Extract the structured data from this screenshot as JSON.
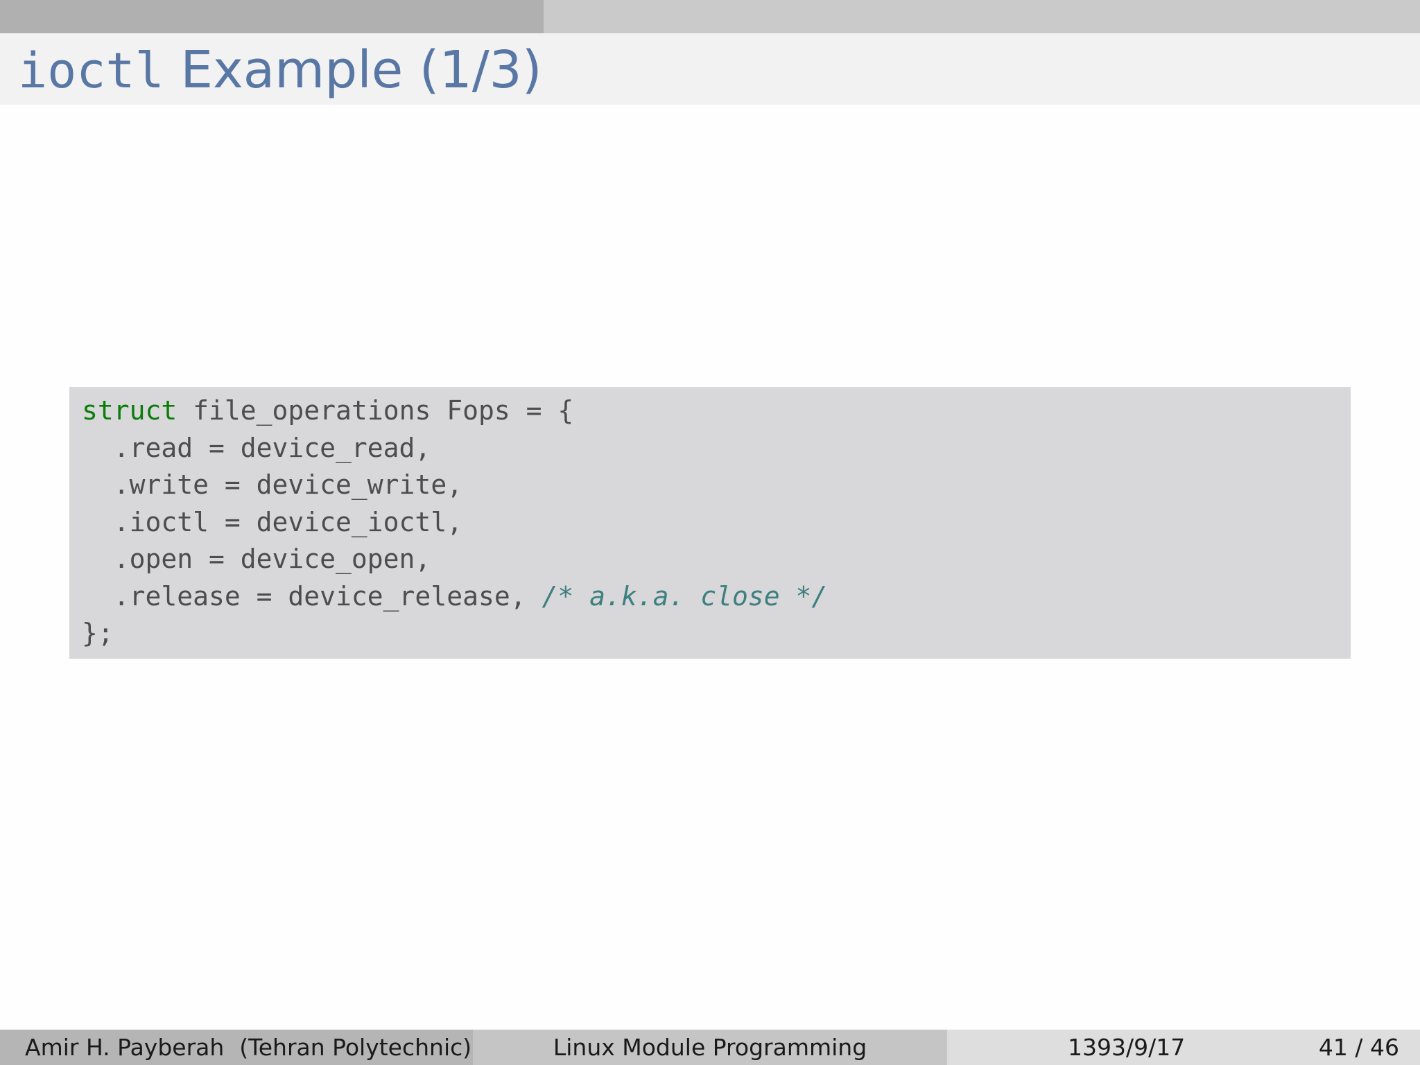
{
  "slide": {
    "title_code": "ioctl",
    "title_text": " Example (1/3)",
    "progress_fraction": 0.383
  },
  "code": {
    "lines": [
      {
        "keyword": "struct",
        "text": " file_operations Fops = {",
        "comment": ""
      },
      {
        "keyword": "",
        "text": "  .read = device_read,",
        "comment": ""
      },
      {
        "keyword": "",
        "text": "  .write = device_write,",
        "comment": ""
      },
      {
        "keyword": "",
        "text": "  .ioctl = device_ioctl,",
        "comment": ""
      },
      {
        "keyword": "",
        "text": "  .open = device_open,",
        "comment": ""
      },
      {
        "keyword": "",
        "text": "  .release = device_release, ",
        "comment": "/* a.k.a. close */"
      },
      {
        "keyword": "",
        "text": "};",
        "comment": ""
      }
    ]
  },
  "footer": {
    "author": "Amir H. Payberah",
    "affiliation": "(Tehran Polytechnic)",
    "talk_title": "Linux Module Programming",
    "date": "1393/9/17",
    "page": "41 / 46"
  },
  "colors": {
    "title": "#5977a5",
    "keyword": "#0a7d0a",
    "comment": "#3e8080",
    "code_background": "#d8d7d9"
  }
}
